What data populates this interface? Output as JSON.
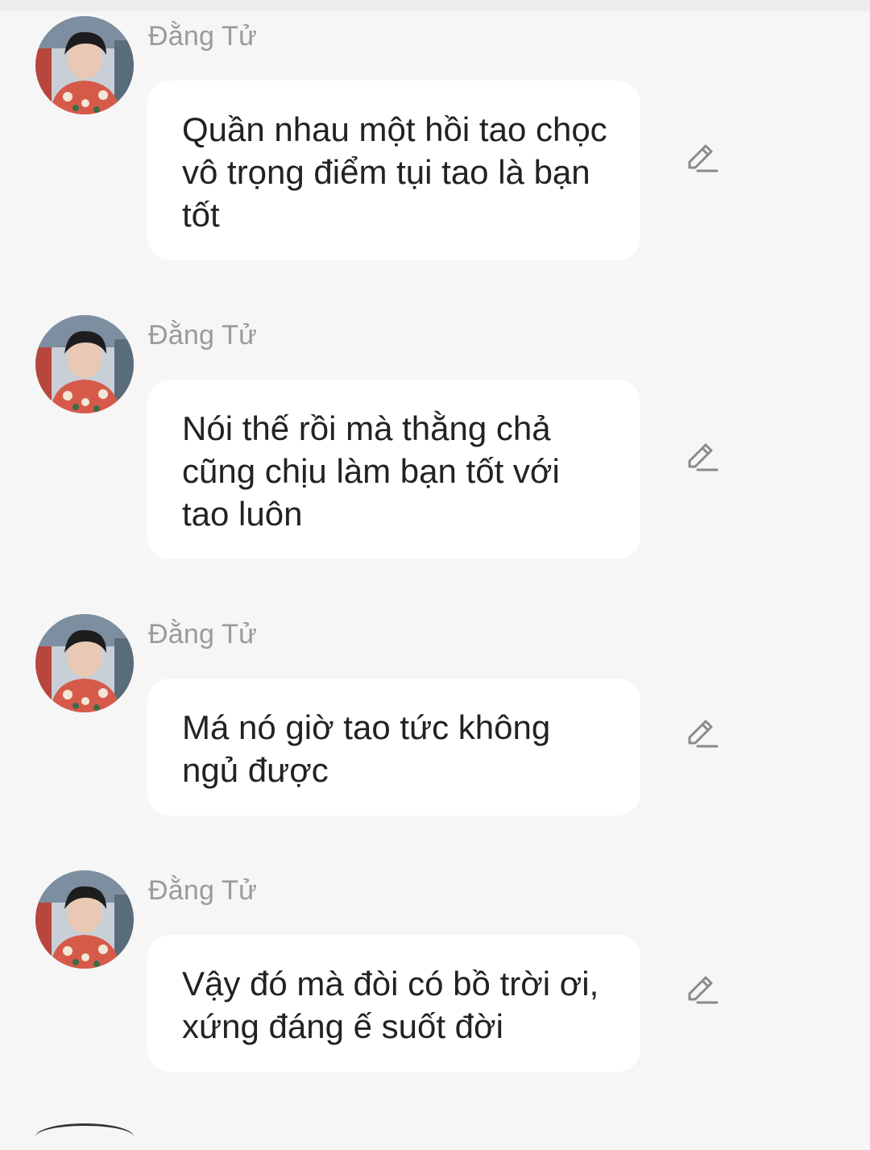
{
  "messages": [
    {
      "sender": "Đằng Tử",
      "text": "Quần nhau một hồi tao chọc vô trọng điểm tụi tao là bạn tốt",
      "action_icon": "pencil-edit-icon"
    },
    {
      "sender": "Đằng Tử",
      "text": "Nói thế rồi mà thằng chả cũng chịu làm bạn tốt với tao luôn",
      "action_icon": "pencil-edit-icon"
    },
    {
      "sender": "Đằng Tử",
      "text": "Má nó giờ tao tức không ngủ được",
      "action_icon": "pencil-edit-icon"
    },
    {
      "sender": "Đằng Tử",
      "text": "Vậy đó mà đòi có bồ trời ơi, xứng đáng ế suốt đời",
      "action_icon": "pencil-edit-icon"
    }
  ],
  "colors": {
    "background": "#f6f6f6",
    "bubble": "#ffffff",
    "sender_name": "#9a9a9a",
    "message_text": "#222222",
    "icon": "#8a8a8a"
  }
}
